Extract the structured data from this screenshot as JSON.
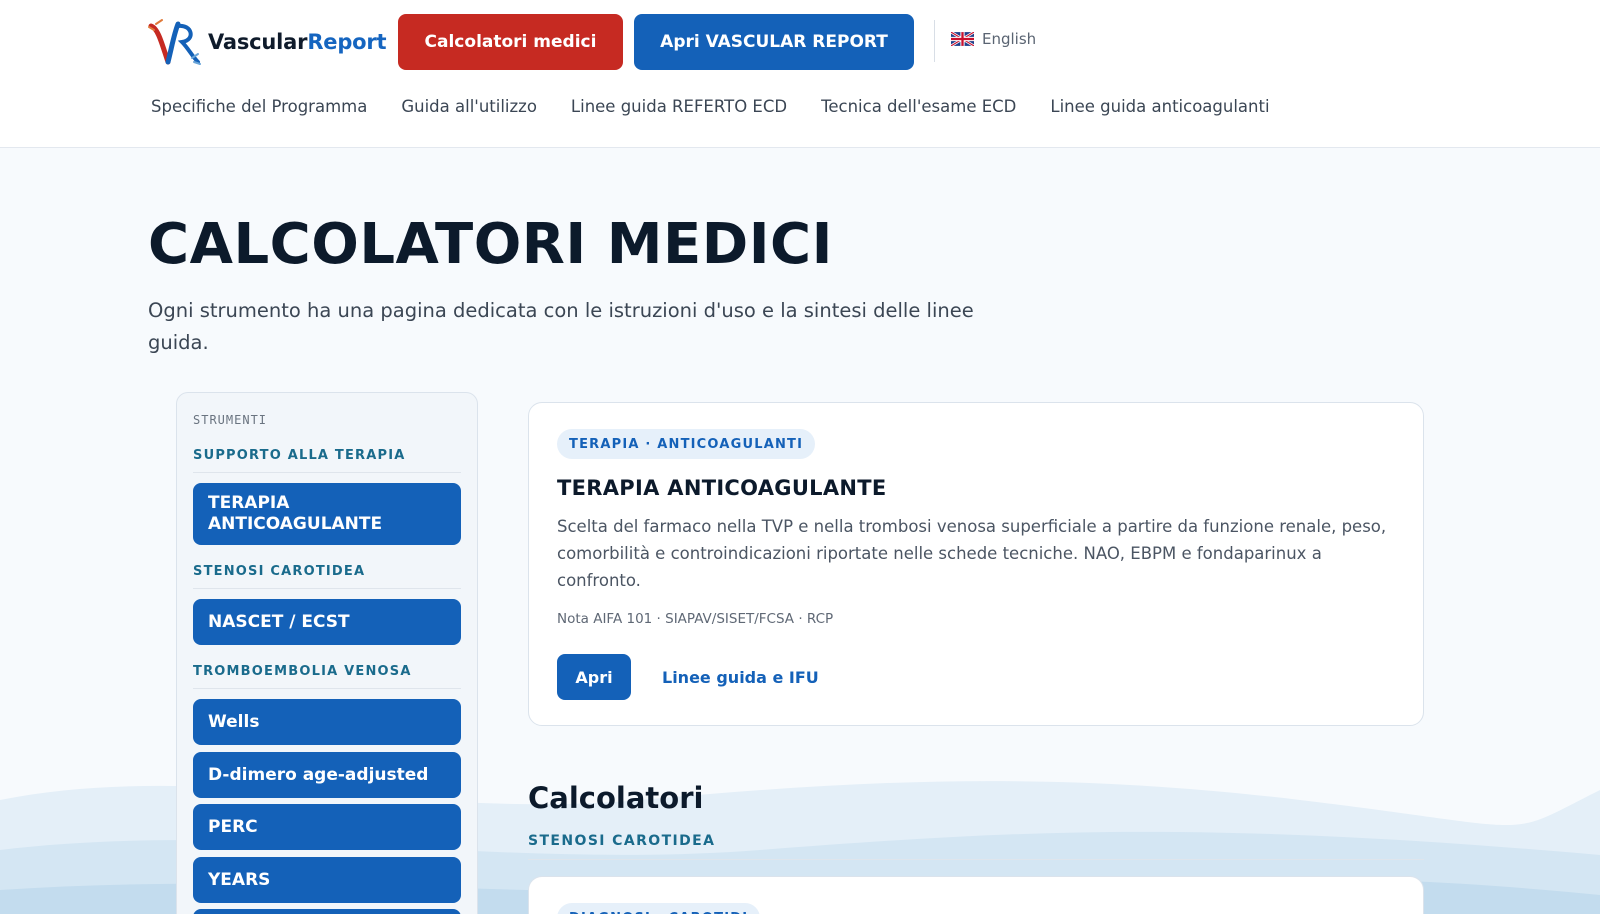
{
  "header": {
    "logo_part1": "Vascular",
    "logo_part2": "Report",
    "btn_calculators": "Calcolatori medici",
    "btn_open_report": "Apri VASCULAR REPORT",
    "language": "English",
    "nav": [
      "Specifiche del Programma",
      "Guida all'utilizzo",
      "Linee guida REFERTO ECD",
      "Tecnica dell'esame ECD",
      "Linee guida anticoagulanti"
    ]
  },
  "hero": {
    "title": "CALCOLATORI MEDICI",
    "subtitle": "Ogni strumento ha una pagina dedicata con le istruzioni d'uso e la sintesi delle linee guida."
  },
  "sidebar": {
    "caption": "STRUMENTI",
    "sections": [
      {
        "title": "SUPPORTO ALLA TERAPIA",
        "items": [
          "TERAPIA ANTICOAGULANTE"
        ]
      },
      {
        "title": "STENOSI CAROTIDEA",
        "items": [
          "NASCET / ECST"
        ]
      },
      {
        "title": "TROMBOEMBOLIA VENOSA",
        "items": [
          "Wells",
          "D-dimero age-adjusted",
          "PERC",
          "YEARS"
        ]
      }
    ]
  },
  "featured": {
    "tag": "TERAPIA · ANTICOAGULANTI",
    "title": "TERAPIA ANTICOAGULANTE",
    "description": "Scelta del farmaco nella TVP e nella trombosi venosa superficiale a partire da funzione renale, peso, comorbilità e controindicazioni riportate nelle schede tecniche. NAO, EBPM e fondaparinux a confronto.",
    "references": "Nota AIFA 101 · SIAPAV/SISET/FCSA · RCP",
    "btn_open": "Apri",
    "link_guides": "Linee guida e IFU"
  },
  "calculators": {
    "title": "Calcolatori",
    "category": "STENOSI CAROTIDEA",
    "next_tag": "DIAGNOSI · CAROTIDI"
  },
  "colors": {
    "primary": "#1461b8",
    "accent_red": "#c62a22",
    "section_teal": "#1a6b8c",
    "text_dark": "#0c1a2b"
  }
}
